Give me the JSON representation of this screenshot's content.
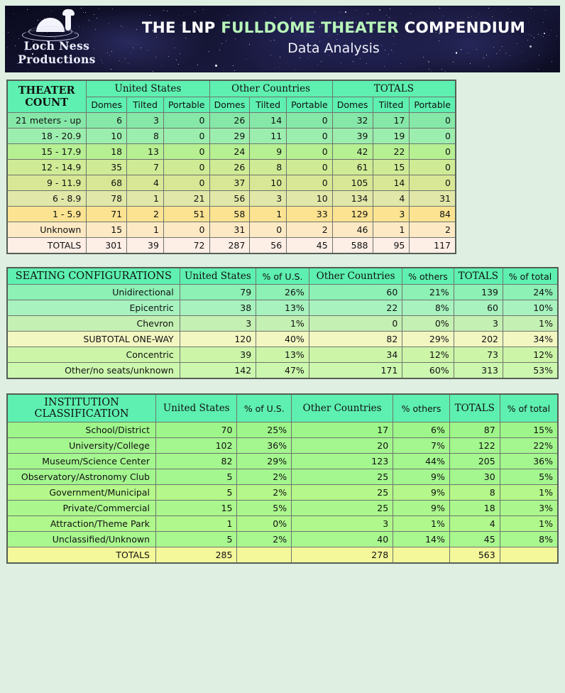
{
  "banner": {
    "logo_line1": "Loch Ness",
    "logo_line2": "Productions",
    "title_part1": "THE LNP ",
    "title_part2": "FULLDOME THEATER",
    "title_part3": " COMPENDIUM",
    "subtitle": "Data Analysis",
    "accent_white": "#ffffff",
    "accent_green": "#b8f5b8",
    "sky_color": "#15152f"
  },
  "theater_count": {
    "corner_title_line1": "THEATER",
    "corner_title_line2": "COUNT",
    "groups": [
      "United States",
      "Other Countries",
      "TOTALS"
    ],
    "subcolumns": [
      "Domes",
      "Tilted",
      "Portable"
    ],
    "rows": [
      {
        "label": "21 meters - up",
        "cells": [
          "6",
          "3",
          "0",
          "26",
          "14",
          "0",
          "32",
          "17",
          "0"
        ],
        "color": "#86e8a8"
      },
      {
        "label": "18 - 20.9",
        "cells": [
          "10",
          "8",
          "0",
          "29",
          "11",
          "0",
          "39",
          "19",
          "0"
        ],
        "color": "#9ceeae"
      },
      {
        "label": "15 - 17.9",
        "cells": [
          "18",
          "13",
          "0",
          "24",
          "9",
          "0",
          "42",
          "22",
          "0"
        ],
        "color": "#b7ef93"
      },
      {
        "label": "12 - 14.9",
        "cells": [
          "35",
          "7",
          "0",
          "26",
          "8",
          "0",
          "61",
          "15",
          "0"
        ],
        "color": "#cfeb96"
      },
      {
        "label": "9 - 11.9",
        "cells": [
          "68",
          "4",
          "0",
          "37",
          "10",
          "0",
          "105",
          "14",
          "0"
        ],
        "color": "#d8e795"
      },
      {
        "label": "6 - 8.9",
        "cells": [
          "78",
          "1",
          "21",
          "56",
          "3",
          "10",
          "134",
          "4",
          "31"
        ],
        "color": "#e1e7a8"
      },
      {
        "label": "1 - 5.9",
        "cells": [
          "71",
          "2",
          "51",
          "58",
          "1",
          "33",
          "129",
          "3",
          "84"
        ],
        "color": "#fbe391"
      },
      {
        "label": "Unknown",
        "cells": [
          "15",
          "1",
          "0",
          "31",
          "0",
          "2",
          "46",
          "1",
          "2"
        ],
        "color": "#fdeac4"
      }
    ],
    "totals": {
      "label": "TOTALS",
      "cells": [
        "301",
        "39",
        "72",
        "287",
        "56",
        "45",
        "588",
        "95",
        "117"
      ],
      "bold_index": [
        0,
        3,
        6
      ],
      "color": "#fdeee6"
    }
  },
  "seating": {
    "title": "SEATING CONFIGURATIONS",
    "columns": [
      "United States",
      "% of U.S.",
      "Other Countries",
      "% others",
      "TOTALS",
      "% of total"
    ],
    "column_bold": [
      true,
      false,
      true,
      false,
      true,
      false
    ],
    "rows": [
      {
        "label": "Unidirectional",
        "cells": [
          "79",
          "26%",
          "60",
          "21%",
          "139",
          "24%"
        ],
        "color": "#8df0b5",
        "bold": false
      },
      {
        "label": "Epicentric",
        "cells": [
          "38",
          "13%",
          "22",
          "8%",
          "60",
          "10%"
        ],
        "color": "#a8f2bf",
        "bold": false
      },
      {
        "label": "Chevron",
        "cells": [
          "3",
          "1%",
          "0",
          "0%",
          "3",
          "1%"
        ],
        "color": "#c4f0b3",
        "bold": false
      },
      {
        "label": "SUBTOTAL ONE-WAY",
        "cells": [
          "120",
          "40%",
          "82",
          "29%",
          "202",
          "34%"
        ],
        "color": "#f2f7c2",
        "bold": true
      },
      {
        "label": "Concentric",
        "cells": [
          "39",
          "13%",
          "34",
          "12%",
          "73",
          "12%"
        ],
        "color": "#ccf5a8",
        "bold": false
      },
      {
        "label": "Other/no seats/unknown",
        "cells": [
          "142",
          "47%",
          "171",
          "60%",
          "313",
          "53%"
        ],
        "color": "#ccf7ae",
        "bold": false
      }
    ]
  },
  "institution": {
    "title_line1": "INSTITUTION",
    "title_line2": "CLASSIFICATION",
    "columns": [
      "United States",
      "% of U.S.",
      "Other Countries",
      "% others",
      "TOTALS",
      "% of total"
    ],
    "column_bold": [
      true,
      false,
      true,
      false,
      true,
      false
    ],
    "rows": [
      {
        "label": "School/District",
        "cells": [
          "70",
          "25%",
          "17",
          "6%",
          "87",
          "15%"
        ],
        "color": "#9ef68a"
      },
      {
        "label": "University/College",
        "cells": [
          "102",
          "36%",
          "20",
          "7%",
          "122",
          "22%"
        ],
        "color": "#a4f68f"
      },
      {
        "label": "Museum/Science Center",
        "cells": [
          "82",
          "29%",
          "123",
          "44%",
          "205",
          "36%"
        ],
        "color": "#a4f68f"
      },
      {
        "label": "Observatory/Astronomy Club",
        "cells": [
          "5",
          "2%",
          "25",
          "9%",
          "30",
          "5%"
        ],
        "color": "#a4f68f"
      },
      {
        "label": "Government/Municipal",
        "cells": [
          "5",
          "2%",
          "25",
          "9%",
          "8",
          "1%"
        ],
        "color": "#b5f78a"
      },
      {
        "label": "Private/Commercial",
        "cells": [
          "15",
          "5%",
          "25",
          "9%",
          "18",
          "3%"
        ],
        "color": "#abf78d"
      },
      {
        "label": "Attraction/Theme Park",
        "cells": [
          "1",
          "0%",
          "3",
          "1%",
          "4",
          "1%"
        ],
        "color": "#b0f78c"
      },
      {
        "label": "Unclassified/Unknown",
        "cells": [
          "5",
          "2%",
          "40",
          "14%",
          "45",
          "8%"
        ],
        "color": "#a8f78f"
      }
    ],
    "totals": {
      "label": "TOTALS",
      "cells": [
        "285",
        "",
        "278",
        "",
        "563",
        ""
      ],
      "color": "#f4f79a"
    }
  }
}
